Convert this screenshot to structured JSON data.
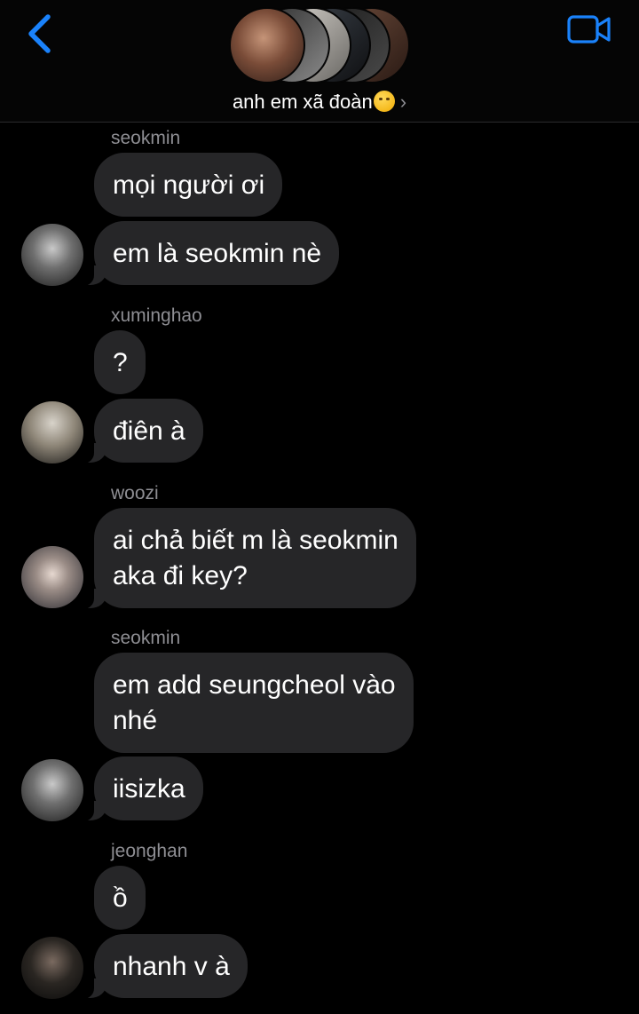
{
  "header": {
    "back_icon": "chevron-left-icon",
    "video_icon": "video-camera-icon",
    "group_name": "anh em xã đoàn",
    "group_emoji": "woozy-face",
    "accent_color": "#1a82fb"
  },
  "messages": [
    {
      "sender": "seokmin",
      "bubbles": [
        "mọi người ơi",
        "em là seokmin nè"
      ]
    },
    {
      "sender": "xuminghao",
      "bubbles": [
        "?",
        "điên à"
      ]
    },
    {
      "sender": "woozi",
      "bubbles": [
        "ai chả biết m là seokmin\naka đi key?"
      ]
    },
    {
      "sender": "seokmin",
      "bubbles": [
        "em add seungcheol vào\nnhé",
        "iisizka"
      ]
    },
    {
      "sender": "jeonghan",
      "bubbles": [
        "ồ",
        "nhanh v à"
      ]
    }
  ]
}
